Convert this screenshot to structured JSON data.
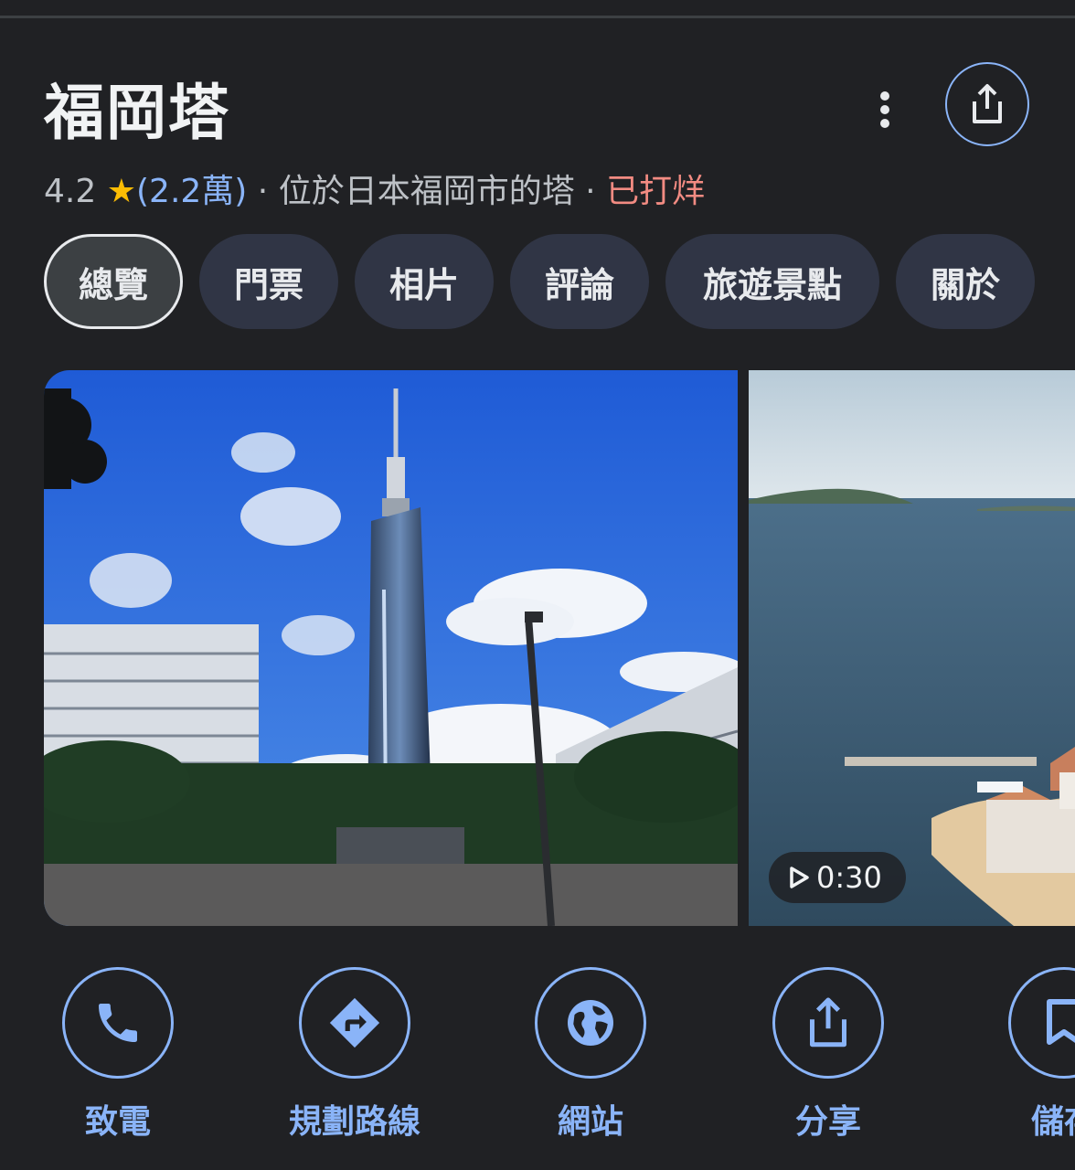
{
  "place": {
    "name": "福岡塔",
    "rating": "4.2",
    "review_count": "(2.2萬)",
    "separator": "·",
    "category": "位於日本福岡市的塔",
    "status": "已打烊"
  },
  "tabs": [
    {
      "label": "總覽",
      "active": true
    },
    {
      "label": "門票"
    },
    {
      "label": "相片"
    },
    {
      "label": "評論"
    },
    {
      "label": "旅遊景點"
    },
    {
      "label": "關於"
    }
  ],
  "photos": {
    "video_duration": "0:30"
  },
  "actions": [
    {
      "label": "致電",
      "icon": "phone-icon"
    },
    {
      "label": "規劃路線",
      "icon": "directions-icon"
    },
    {
      "label": "網站",
      "icon": "globe-icon"
    },
    {
      "label": "分享",
      "icon": "share-icon"
    },
    {
      "label": "儲存",
      "icon": "bookmark-icon"
    }
  ],
  "colors": {
    "background": "#202124",
    "accent": "#8ab4f8",
    "star": "#fbbc04",
    "closed": "#f28b82"
  }
}
